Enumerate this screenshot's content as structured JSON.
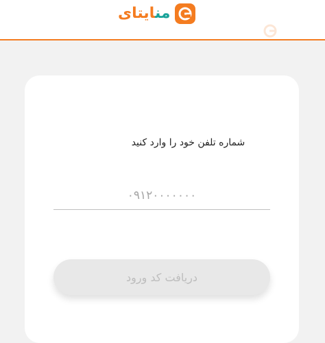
{
  "brand": {
    "name_part_a": "ایتای",
    "name_part_b": "من",
    "accent_color": "#f47c20",
    "secondary_color": "#1aa39a"
  },
  "login": {
    "prompt": "شماره تلفن خود را وارد کنید",
    "phone_placeholder": "۰۹۱۲۰۰۰۰۰۰۰",
    "phone_value": "",
    "submit_label": "دریافت کد ورود"
  }
}
